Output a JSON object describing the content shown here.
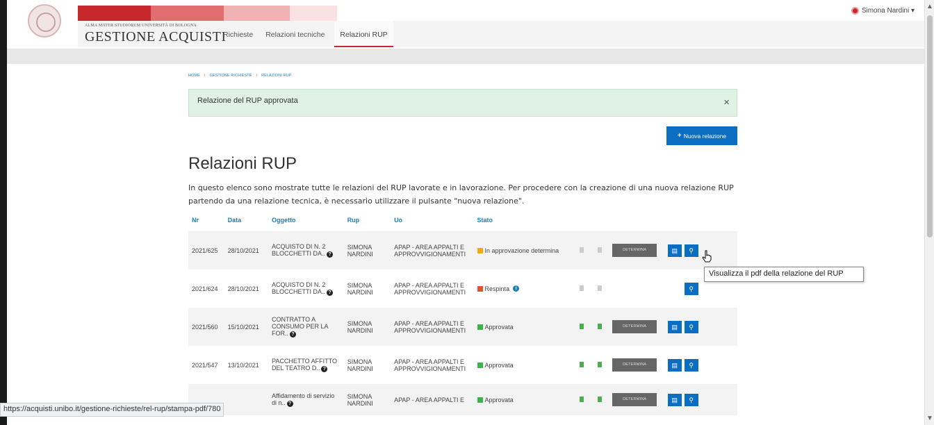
{
  "header": {
    "university": "ALMA MATER STUDIORUM UNIVERSITÀ DI BOLOGNA",
    "app_title": "GESTIONE ACQUISTI",
    "nav": [
      "Richieste",
      "Relazioni tecniche",
      "Relazioni RUP"
    ],
    "user": "Simona Nardini ▾"
  },
  "breadcrumb": [
    "HOME",
    "GESTIONE RICHIESTE",
    "RELAZIONI RUP"
  ],
  "alert": {
    "message": "Relazione del RUP approvata",
    "close": "×"
  },
  "new_button": "Nuova relazione",
  "page_title": "Relazioni RUP",
  "intro": "In questo elenco sono mostrate tutte le relazioni del RUP lavorate e in lavorazione. Per procedere con la creazione di una nuova relazione RUP partendo da una relazione tecnica, è necessario utilizzare il pulsante \"nuova relazione\".",
  "table": {
    "headers": [
      "Nr",
      "Data",
      "Oggetto",
      "Rup",
      "Uo",
      "Stato"
    ],
    "rows": [
      {
        "nr": "2021/625",
        "data": "28/10/2021",
        "oggetto": "ACQUISTO DI N. 2 BLOCCHETTI DA..",
        "rup": "SIMONA NARDINI",
        "uo": "APAP - AREA APPALTI E APPROVVIGIONAMENTI",
        "stato": "In approvazione determina",
        "stato_color": "#f0a81e",
        "det": "DETERMINA"
      },
      {
        "nr": "2021/624",
        "data": "28/10/2021",
        "oggetto": "ACQUISTO DI N. 2 BLOCCHETTI DA..",
        "rup": "SIMONA NARDINI",
        "uo": "APAP - AREA APPALTI E APPROVVIGIONAMENTI",
        "stato": "Respinta",
        "stato_color": "#e0522b",
        "det": ""
      },
      {
        "nr": "2021/560",
        "data": "15/10/2021",
        "oggetto": "CONTRATTO A CONSUMO PER LA FOR..",
        "rup": "SIMONA NARDINI",
        "uo": "APAP - AREA APPALTI E APPROVVIGIONAMENTI",
        "stato": "Approvata",
        "stato_color": "#3cb34a",
        "det": "DETERMINA"
      },
      {
        "nr": "2021/547",
        "data": "13/10/2021",
        "oggetto": "PACCHETTO AFFITTO DEL TEATRO D..",
        "rup": "SIMONA NARDINI",
        "uo": "APAP - AREA APPALTI E APPROVVIGIONAMENTI",
        "stato": "Approvata",
        "stato_color": "#3cb34a",
        "det": "DETERMINA"
      },
      {
        "nr": "",
        "data": "",
        "oggetto": "Affidamento di servizio di n..",
        "rup": "SIMONA NARDINI",
        "uo": "APAP - AREA APPALTI E",
        "stato": "Approvata",
        "stato_color": "#3cb34a",
        "det": "DETERMINA"
      }
    ]
  },
  "tooltip": "Visualizza il pdf della relazione del RUP",
  "status_url": "https://acquisti.unibo.it/gestione-richieste/rel-rup/stampa-pdf/780"
}
